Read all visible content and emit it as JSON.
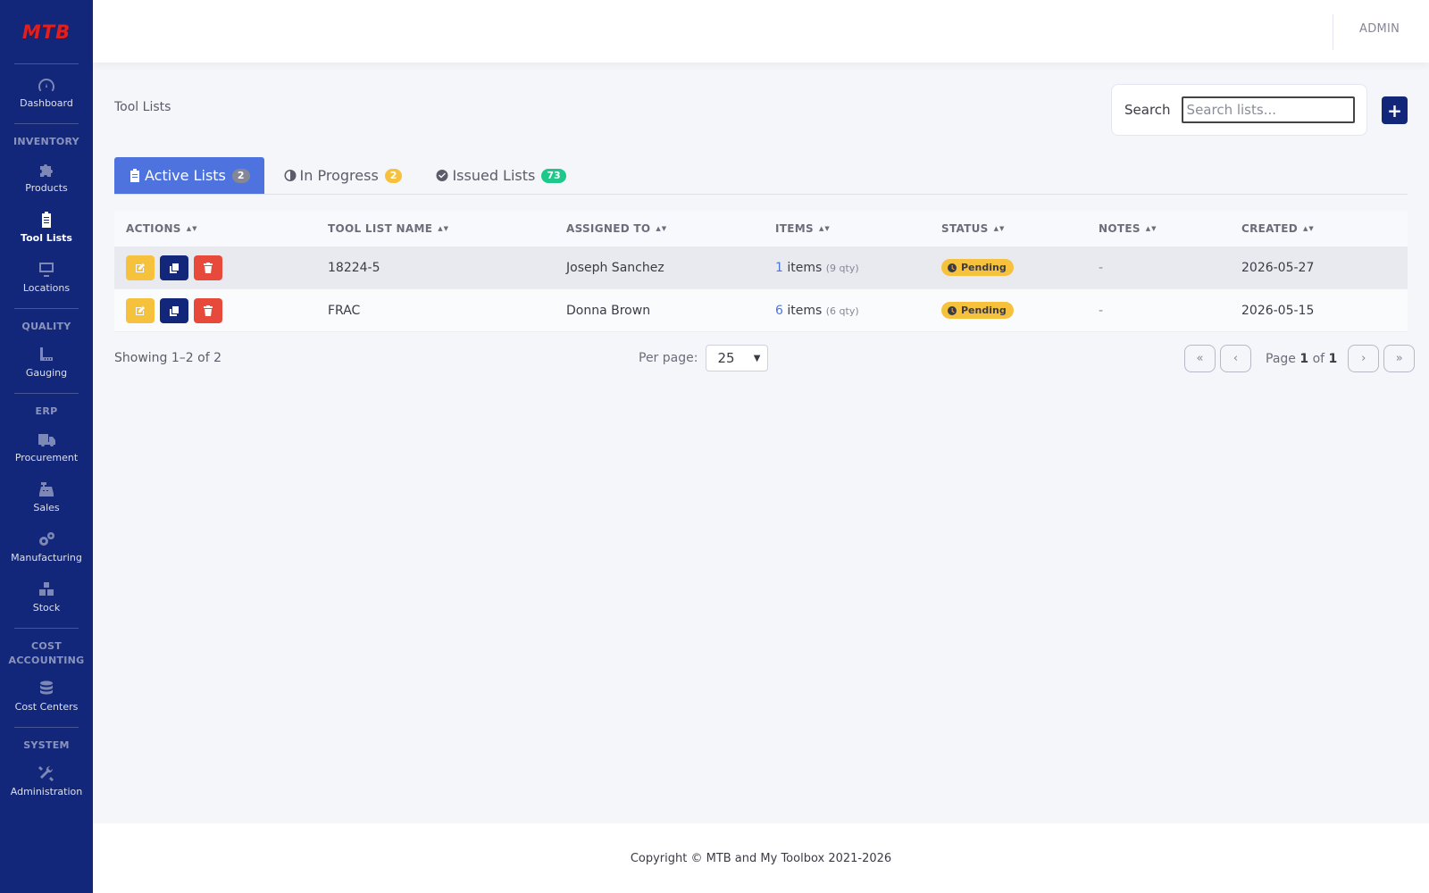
{
  "app": {
    "logo_text": "MTB",
    "user": "ADMIN"
  },
  "sidebar": {
    "items": [
      {
        "type": "item",
        "label": "Dashboard",
        "icon": "dashboard-gauge-icon"
      },
      {
        "type": "heading",
        "label": "INVENTORY"
      },
      {
        "type": "item",
        "label": "Products",
        "icon": "puzzle-icon"
      },
      {
        "type": "item",
        "label": "Tool Lists",
        "icon": "clipboard-icon",
        "active": true
      },
      {
        "type": "item",
        "label": "Locations",
        "icon": "monitor-icon"
      },
      {
        "type": "heading",
        "label": "QUALITY"
      },
      {
        "type": "item",
        "label": "Gauging",
        "icon": "ruler-icon"
      },
      {
        "type": "heading",
        "label": "ERP"
      },
      {
        "type": "item",
        "label": "Procurement",
        "icon": "truck-icon"
      },
      {
        "type": "item",
        "label": "Sales",
        "icon": "cash-register-icon"
      },
      {
        "type": "item",
        "label": "Manufacturing",
        "icon": "cogs-icon"
      },
      {
        "type": "item",
        "label": "Stock",
        "icon": "boxes-icon"
      },
      {
        "type": "heading",
        "label": "COST ACCOUNTING"
      },
      {
        "type": "item",
        "label": "Cost Centers",
        "icon": "coins-icon"
      },
      {
        "type": "heading",
        "label": "SYSTEM"
      },
      {
        "type": "item",
        "label": "Administration",
        "icon": "tools-icon"
      }
    ]
  },
  "page": {
    "title": "Tool Lists"
  },
  "search": {
    "label": "Search",
    "placeholder": "Search lists..."
  },
  "add_button": {
    "label": "+"
  },
  "tabs": [
    {
      "label": "Active Lists",
      "count": "2",
      "icon": "clipboard-icon",
      "active": true
    },
    {
      "label": "In Progress",
      "count": "2",
      "icon": "half-circle-icon"
    },
    {
      "label": "Issued Lists",
      "count": "73",
      "icon": "check-circle-icon"
    }
  ],
  "table": {
    "columns": [
      "ACTIONS",
      "TOOL LIST NAME",
      "ASSIGNED TO",
      "ITEMS",
      "STATUS",
      "NOTES",
      "CREATED"
    ],
    "rows": [
      {
        "name": "18224-5",
        "assigned_to": "Joseph Sanchez",
        "items_count": "1",
        "items_word": "items",
        "qty": "(9 qty)",
        "status": "Pending",
        "notes": "-",
        "created": "2026-05-27"
      },
      {
        "name": "FRAC",
        "assigned_to": "Donna Brown",
        "items_count": "6",
        "items_word": "items",
        "qty": "(6 qty)",
        "status": "Pending",
        "notes": "-",
        "created": "2026-05-15"
      }
    ]
  },
  "pagination": {
    "showing": "Showing 1–2 of 2",
    "per_page_label": "Per page:",
    "per_page_value": "25",
    "first": "«",
    "prev": "‹",
    "next": "›",
    "last": "»",
    "page_word": "Page",
    "current_page": "1",
    "of_word": "of",
    "total_pages": "1"
  },
  "footer": {
    "copyright": "Copyright © MTB and My Toolbox 2021-2026"
  },
  "colors": {
    "sidebar": "#13277a",
    "primary": "#4e73df",
    "warning": "#f6c23e",
    "danger": "#e74a3b",
    "success": "#1cc88a"
  }
}
